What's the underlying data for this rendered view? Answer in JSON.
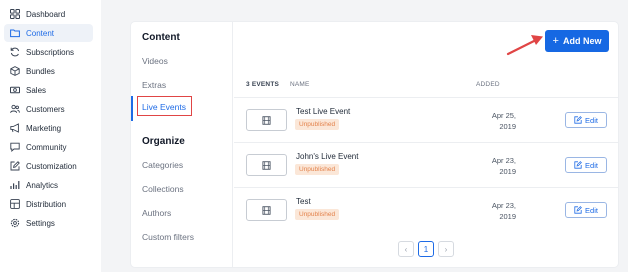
{
  "sidebar": {
    "items": [
      {
        "label": "Dashboard",
        "icon": "dashboard-icon"
      },
      {
        "label": "Content",
        "icon": "folder-icon",
        "active": true
      },
      {
        "label": "Subscriptions",
        "icon": "refresh-icon"
      },
      {
        "label": "Bundles",
        "icon": "box-icon"
      },
      {
        "label": "Sales",
        "icon": "cash-icon"
      },
      {
        "label": "Customers",
        "icon": "users-icon"
      },
      {
        "label": "Marketing",
        "icon": "megaphone-icon"
      },
      {
        "label": "Community",
        "icon": "chat-icon"
      },
      {
        "label": "Customization",
        "icon": "edit-square-icon"
      },
      {
        "label": "Analytics",
        "icon": "bar-chart-icon"
      },
      {
        "label": "Distribution",
        "icon": "distribution-icon"
      },
      {
        "label": "Settings",
        "icon": "gear-icon"
      }
    ]
  },
  "content_nav": {
    "heading": "Content",
    "items": [
      "Videos",
      "Extras",
      "Live Events"
    ],
    "active": "Live Events",
    "organize_heading": "Organize",
    "organize_items": [
      "Categories",
      "Collections",
      "Authors",
      "Custom filters"
    ]
  },
  "toolbar": {
    "add_new_label": "Add New"
  },
  "table": {
    "count_header": "3 EVENTS",
    "name_header": "NAME",
    "added_header": "ADDED",
    "rows": [
      {
        "name": "Test Live Event",
        "status": "Unpublished",
        "date_line1": "Apr 25,",
        "date_line2": "2019",
        "edit_label": "Edit"
      },
      {
        "name": "John's Live Event",
        "status": "Unpublished",
        "date_line1": "Apr 23,",
        "date_line2": "2019",
        "edit_label": "Edit"
      },
      {
        "name": "Test",
        "status": "Unpublished",
        "date_line1": "Apr 23,",
        "date_line2": "2019",
        "edit_label": "Edit"
      }
    ]
  },
  "pagination": {
    "prev": "‹",
    "current": "1",
    "next": "›"
  },
  "colors": {
    "accent": "#1668e3",
    "highlight_box": "#e04545",
    "badge_bg": "#fbe7d8",
    "badge_text": "#e3824b"
  }
}
